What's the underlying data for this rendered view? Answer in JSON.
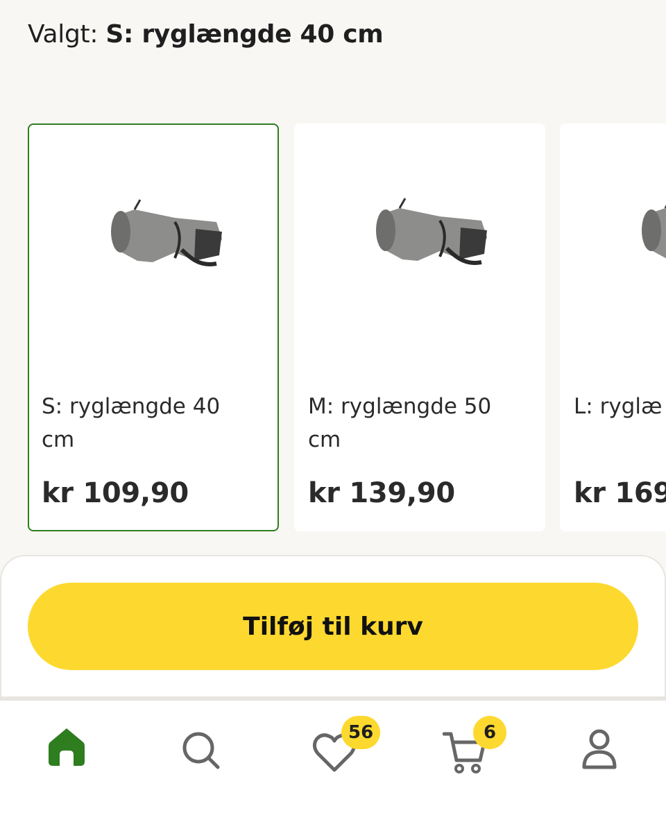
{
  "selected": {
    "prefix": "Valgt:",
    "value": "S: ryglængde 40 cm"
  },
  "variants": [
    {
      "name": "S: ryglængde 40 cm",
      "price": "kr 109,90",
      "selected": true
    },
    {
      "name": "M: ryglængde 50 cm",
      "price": "kr 139,90",
      "selected": false
    },
    {
      "name": "L: ryglæ",
      "price": "kr 169",
      "selected": false
    }
  ],
  "add_to_cart": {
    "label": "Tilføj til kurv"
  },
  "tabbar": {
    "favorites_count": "56",
    "cart_count": "6",
    "icons": [
      "home-icon",
      "search-icon",
      "heart-icon",
      "cart-icon",
      "user-icon"
    ]
  },
  "colors": {
    "accent_green": "#2e7d1f",
    "button_yellow": "#fdd930",
    "background": "#f8f7f4"
  }
}
